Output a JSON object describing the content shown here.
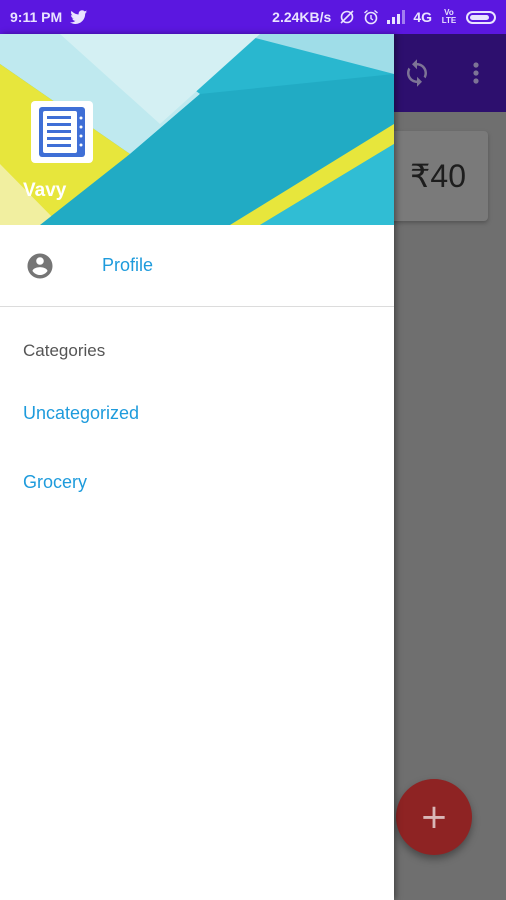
{
  "status_bar": {
    "time": "9:11 PM",
    "network_speed": "2.24KB/s",
    "network_type": "4G",
    "volte_label": "Vo LTE",
    "icons": [
      "twitter-icon",
      "sync-off-icon",
      "alarm-icon",
      "signal-icon",
      "battery-icon"
    ]
  },
  "toolbar": {
    "icons": [
      "sync-icon",
      "more-vert-icon"
    ]
  },
  "background_content": {
    "price": "₹40",
    "fab_label": "+"
  },
  "drawer": {
    "header": {
      "user_name": "Vavy",
      "logo_icon": "notes-list-icon"
    },
    "profile_item": {
      "label": "Profile",
      "icon": "account-circle-icon"
    },
    "section_title": "Categories",
    "categories": [
      {
        "label": "Uncategorized"
      },
      {
        "label": "Grocery"
      }
    ]
  },
  "colors": {
    "status_bar": "#5b17e0",
    "toolbar_dimmed": "#2d0f6e",
    "accent_link": "#1e9bdc",
    "fab": "#8e2323",
    "header_teal": "#29b7cf",
    "header_yellow": "#e7e63c"
  }
}
